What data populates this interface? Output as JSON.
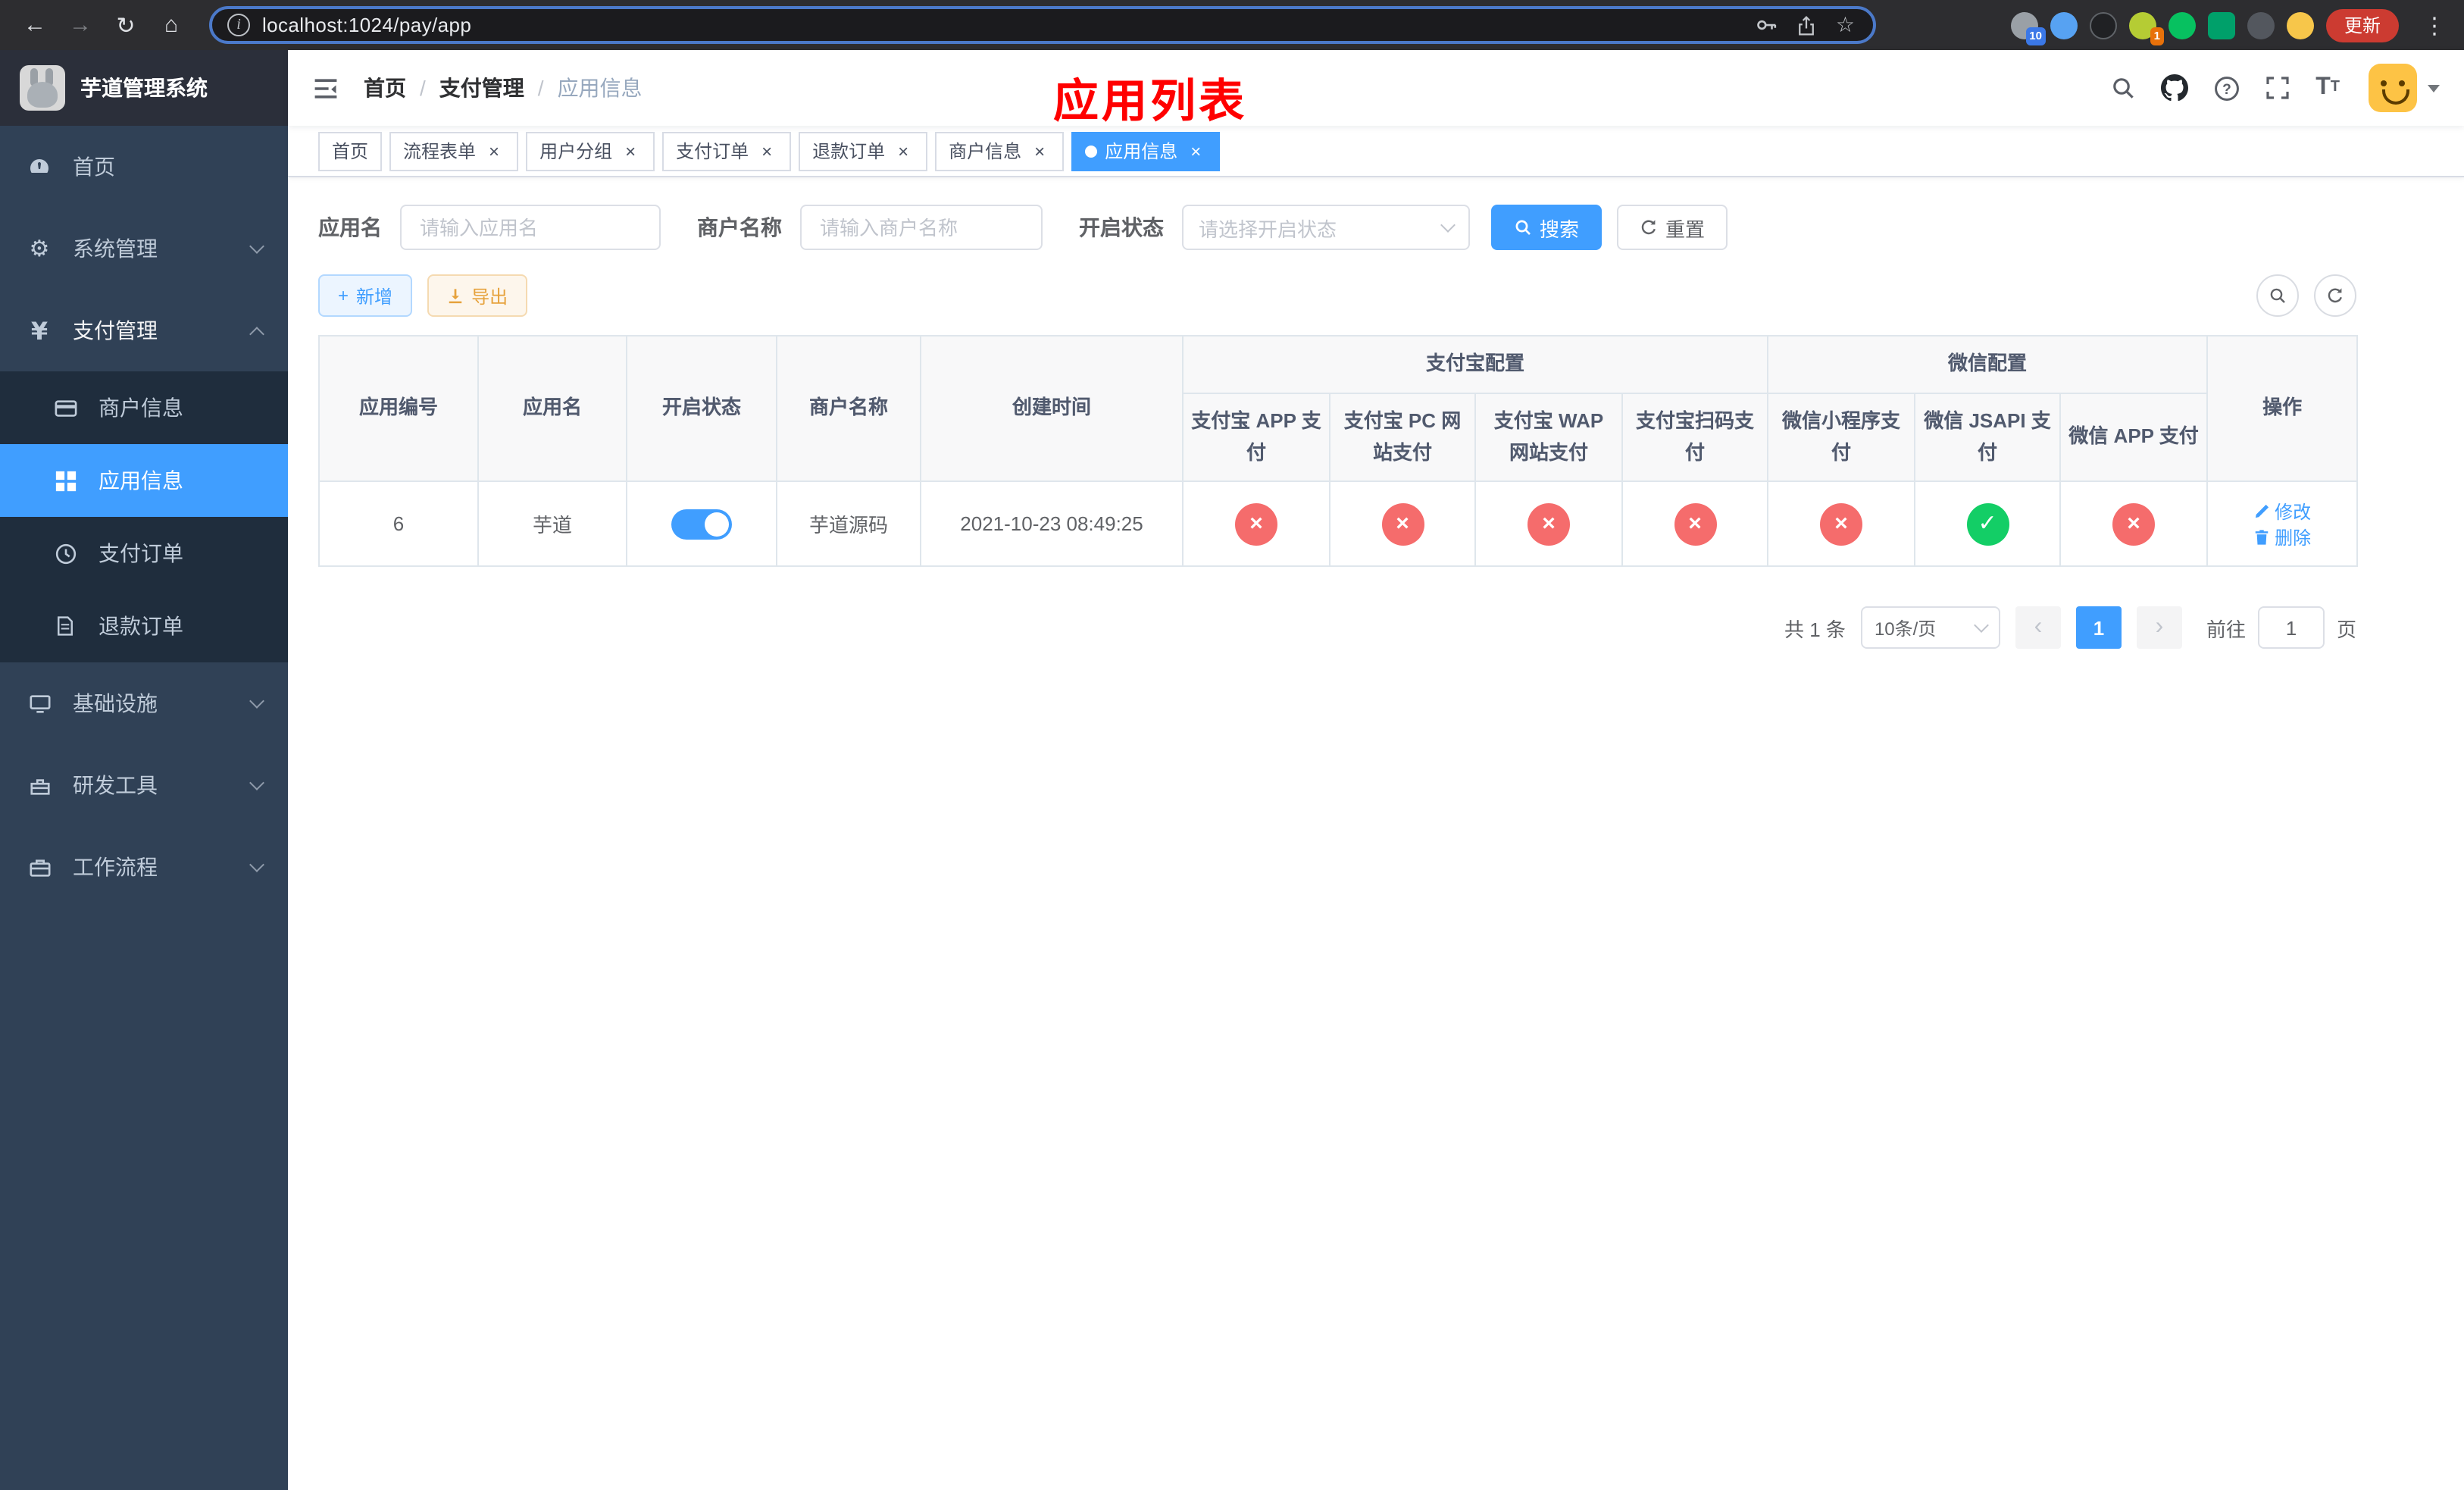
{
  "browser": {
    "url": "localhost:1024/pay/app",
    "update_label": "更新",
    "extension_badge_count": "10",
    "profile_badge_count": "1"
  },
  "icons": {
    "back": "←",
    "forward": "→",
    "reload": "↻",
    "home": "⌂",
    "info": "i",
    "star": "☆",
    "menu": "⋮",
    "close": "×",
    "check": "✓",
    "cross": "×",
    "plus": "+",
    "gear": "⚙",
    "yen": "¥",
    "prev": "‹",
    "next": "›"
  },
  "sidebar": {
    "app_title": "芋道管理系统",
    "menu": [
      {
        "label": "首页"
      },
      {
        "label": "系统管理"
      },
      {
        "label": "支付管理"
      },
      {
        "label": "基础设施"
      },
      {
        "label": "研发工具"
      },
      {
        "label": "工作流程"
      }
    ],
    "submenu": [
      {
        "label": "商户信息"
      },
      {
        "label": "应用信息",
        "active": true
      },
      {
        "label": "支付订单"
      },
      {
        "label": "退款订单"
      }
    ]
  },
  "header": {
    "breadcrumb": [
      "首页",
      "支付管理",
      "应用信息"
    ],
    "breadcrumb_separator": "/",
    "annotation": "应用列表",
    "annotation_color": "#ff0000"
  },
  "tabs": [
    {
      "label": "首页",
      "closable": false,
      "active": false
    },
    {
      "label": "流程表单",
      "closable": true,
      "active": false
    },
    {
      "label": "用户分组",
      "closable": true,
      "active": false
    },
    {
      "label": "支付订单",
      "closable": true,
      "active": false
    },
    {
      "label": "退款订单",
      "closable": true,
      "active": false
    },
    {
      "label": "商户信息",
      "closable": true,
      "active": false
    },
    {
      "label": "应用信息",
      "closable": true,
      "active": true
    }
  ],
  "filters": {
    "app_name_label": "应用名",
    "app_name_placeholder": "请输入应用名",
    "merchant_label": "商户名称",
    "merchant_placeholder": "请输入商户名称",
    "status_label": "开启状态",
    "status_placeholder": "请选择开启状态",
    "search_label": "搜索",
    "reset_label": "重置"
  },
  "toolbar": {
    "add_label": "新增",
    "export_label": "导出"
  },
  "table": {
    "columns": [
      "应用编号",
      "应用名",
      "开启状态",
      "商户名称",
      "创建时间"
    ],
    "group_alipay": {
      "label": "支付宝配置",
      "children": [
        "支付宝 APP 支付",
        "支付宝 PC 网站支付",
        "支付宝 WAP 网站支付",
        "支付宝扫码支付"
      ]
    },
    "group_wechat": {
      "label": "微信配置",
      "children": [
        "微信小程序支付",
        "微信 JSAPI 支付",
        "微信 APP 支付"
      ]
    },
    "ops_header": "操作",
    "rows": [
      {
        "app_id": "6",
        "app_name": "芋道",
        "enabled": true,
        "merchant_name": "芋道源码",
        "create_time": "2021-10-23 08:49:25",
        "configs": {
          "alipay_app": false,
          "alipay_pc": false,
          "alipay_wap": false,
          "alipay_qr": false,
          "wx_lite": false,
          "wx_jsapi": true,
          "wx_app": false
        },
        "actions": [
          "修改",
          "删除"
        ]
      }
    ]
  },
  "pagination": {
    "total_text": "共 1 条",
    "page_size": "10条/页",
    "current_page": "1",
    "goto_prefix": "前往",
    "goto_value": "1",
    "goto_suffix": "页"
  },
  "colors": {
    "primary": "#409eff",
    "success": "#13ce66",
    "danger": "#f56c6c",
    "sidebar_bg": "#304156",
    "submenu_bg": "#1f2d3d"
  }
}
